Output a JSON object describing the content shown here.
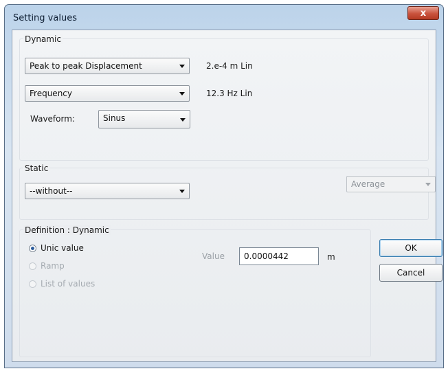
{
  "window": {
    "title": "Setting values",
    "close_glyph": "x"
  },
  "dynamic": {
    "label": "Dynamic",
    "quantity_selected": "Peak to peak Displacement",
    "quantity_readout": "2.e-4 m Lin",
    "frequency_selected": "Frequency",
    "frequency_readout": "12.3 Hz Lin",
    "waveform_label": "Waveform:",
    "waveform_selected": "Sinus"
  },
  "static": {
    "label": "Static",
    "selected": "--without--",
    "mode_selected": "Average"
  },
  "definition": {
    "label": "Definition : Dynamic",
    "options": [
      {
        "label": "Unic value",
        "checked": true,
        "enabled": true
      },
      {
        "label": "Ramp",
        "checked": false,
        "enabled": false
      },
      {
        "label": "List of values",
        "checked": false,
        "enabled": false
      }
    ],
    "value_label": "Value",
    "value": "0.0000442",
    "unit": "m"
  },
  "buttons": {
    "ok": "OK",
    "cancel": "Cancel"
  },
  "colors": {
    "title_bar": "#bcd3ea",
    "close": "#c9533d",
    "accent": "#3c7fb1"
  },
  "icons": [
    "close-icon",
    "chevron-down-icon",
    "radio-icon"
  ]
}
